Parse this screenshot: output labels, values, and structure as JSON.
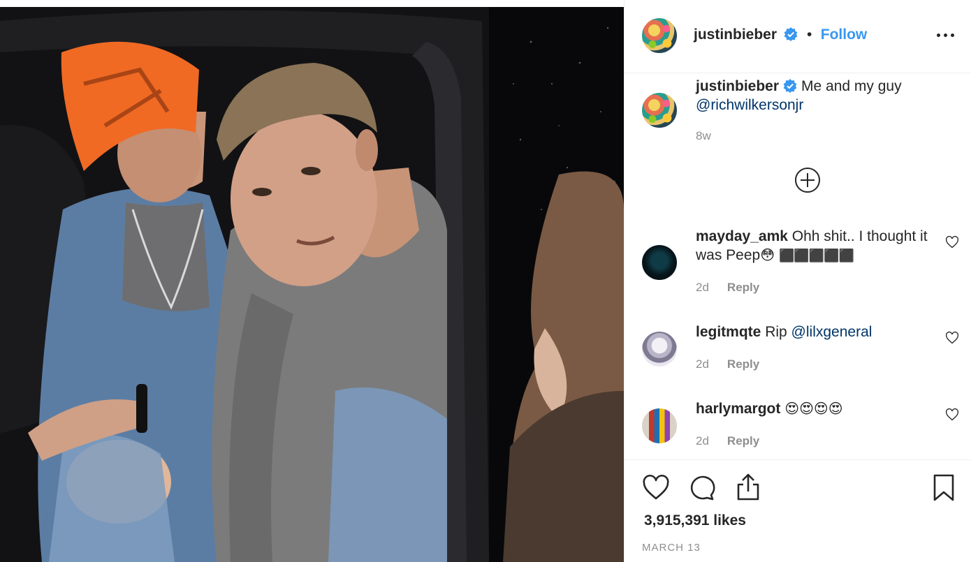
{
  "post": {
    "author": {
      "username": "justinbieber",
      "verified": true,
      "follow_label": "Follow",
      "separator": "•"
    },
    "caption": {
      "username": "justinbieber",
      "text": "Me and my guy",
      "mention": "@richwilkersonjr",
      "age": "8w"
    },
    "comments": [
      {
        "username": "mayday_amk",
        "text": "Ohh shit.. I thought it was Peep",
        "emoji_tail": "😳",
        "blocks": "⬛⬛⬛⬛⬛",
        "age": "2d",
        "reply_label": "Reply"
      },
      {
        "username": "legitmqte",
        "text": "Rip",
        "mention": "@lilxgeneral",
        "age": "2d",
        "reply_label": "Reply"
      },
      {
        "username": "harlymargot",
        "text": "😍😍😍😍",
        "age": "2d",
        "reply_label": "Reply"
      }
    ],
    "likes": "3,915,391 likes",
    "date": "MARCH 13"
  },
  "colors": {
    "accent": "#3897f0",
    "mention": "#003569",
    "muted": "#8e8e8e",
    "text": "#262626",
    "divider": "#efefef"
  },
  "icons": {
    "more": "more-horizontal-icon",
    "load_more": "plus-circle-icon",
    "like": "heart-icon",
    "comment": "comment-bubble-icon",
    "share": "share-icon",
    "save": "bookmark-icon",
    "verified": "verified-badge-icon"
  }
}
